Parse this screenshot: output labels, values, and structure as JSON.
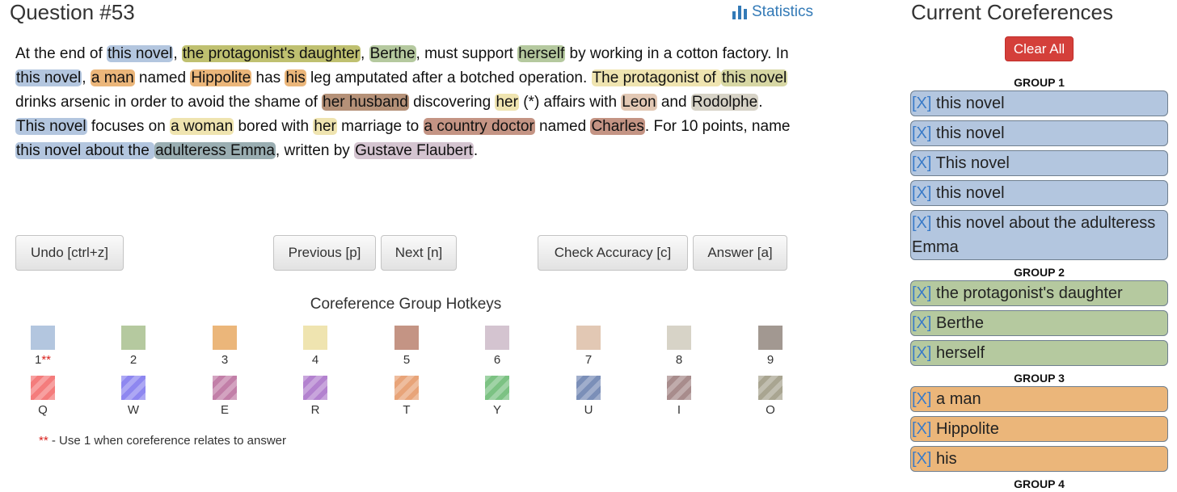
{
  "header": {
    "title": "Question #53",
    "stats_label": "Statistics"
  },
  "question": {
    "segments": [
      {
        "t": "At the end of "
      },
      {
        "t": "this novel",
        "g": "c1"
      },
      {
        "t": ", "
      },
      {
        "t": "the protagonist's daughter",
        "g": "c25"
      },
      {
        "t": ", "
      },
      {
        "t": "Berthe",
        "g": "c2"
      },
      {
        "t": ", must support "
      },
      {
        "t": "herself",
        "g": "c2"
      },
      {
        "t": " by working in a cotton factory. In "
      },
      {
        "t": "this novel",
        "g": "c1"
      },
      {
        "t": ", "
      },
      {
        "t": "a man",
        "g": "c3"
      },
      {
        "t": " named "
      },
      {
        "t": "Hippolite",
        "g": "c3"
      },
      {
        "t": " has "
      },
      {
        "t": "his",
        "g": "c3"
      },
      {
        "t": " leg amputated after a botched operation. "
      },
      {
        "t": "The protagonist of ",
        "g": "c4"
      },
      {
        "t": "this novel",
        "g": "c4g"
      },
      {
        "t": " drinks arsenic in order to avoid the shame of "
      },
      {
        "t": "her husband",
        "g": "c45"
      },
      {
        "t": " discovering "
      },
      {
        "t": "her",
        "g": "c4"
      },
      {
        "t": " (*) affairs with "
      },
      {
        "t": "Leon",
        "g": "c7"
      },
      {
        "t": " and "
      },
      {
        "t": "Rodolphe",
        "g": "c8"
      },
      {
        "t": ". "
      },
      {
        "t": "This novel",
        "g": "c1"
      },
      {
        "t": " focuses on "
      },
      {
        "t": "a woman",
        "g": "c4"
      },
      {
        "t": " bored with "
      },
      {
        "t": "her",
        "g": "c4"
      },
      {
        "t": " marriage to "
      },
      {
        "t": "a country doctor",
        "g": "c5"
      },
      {
        "t": " named "
      },
      {
        "t": "Charles",
        "g": "c5"
      },
      {
        "t": ". For 10 points, name "
      },
      {
        "t": "this novel about the ",
        "g": "c1"
      },
      {
        "t": "adulteress Emma",
        "g": "c1g"
      },
      {
        "t": ", written by "
      },
      {
        "t": "Gustave Flaubert",
        "g": "c6"
      },
      {
        "t": "."
      }
    ]
  },
  "buttons": {
    "undo": "Undo [ctrl+z]",
    "previous": "Previous [p]",
    "next": "Next [n]",
    "check": "Check Accuracy [c]",
    "answer": "Answer [a]"
  },
  "hotkeys": {
    "title": "Coreference Group Hotkeys",
    "row1": [
      {
        "key": "1",
        "color": "#b3c6df",
        "mark": "**"
      },
      {
        "key": "2",
        "color": "#b5c99f"
      },
      {
        "key": "3",
        "color": "#ebb67a"
      },
      {
        "key": "4",
        "color": "#efe4b0"
      },
      {
        "key": "5",
        "color": "#c49484"
      },
      {
        "key": "6",
        "color": "#d4c4d0"
      },
      {
        "key": "7",
        "color": "#e2c8b4"
      },
      {
        "key": "8",
        "color": "#d7d3c7"
      },
      {
        "key": "9",
        "color": "#a29891"
      }
    ],
    "row2": [
      {
        "key": "Q",
        "color": "#f47c7c"
      },
      {
        "key": "W",
        "color": "#8e87f0"
      },
      {
        "key": "E",
        "color": "#c27fa8"
      },
      {
        "key": "R",
        "color": "#b382cf"
      },
      {
        "key": "T",
        "color": "#e8a479"
      },
      {
        "key": "Y",
        "color": "#7cc283"
      },
      {
        "key": "U",
        "color": "#7b8fb8"
      },
      {
        "key": "I",
        "color": "#a88c8c"
      },
      {
        "key": "O",
        "color": "#a9a591"
      }
    ],
    "note_mark": "**",
    "note_text": " - Use 1 when coreference relates to answer"
  },
  "panel": {
    "title": "Current Coreferences",
    "clear_label": "Clear All",
    "remove_label": "[X]",
    "groups": [
      {
        "label": "GROUP 1",
        "color": "#b3c6df",
        "items": [
          "this novel",
          "this novel",
          "This novel",
          "this novel",
          "this novel about the adulteress Emma"
        ]
      },
      {
        "label": "GROUP 2",
        "color": "#b5c99f",
        "items": [
          "the protagonist's daughter",
          "Berthe",
          "herself"
        ]
      },
      {
        "label": "GROUP 3",
        "color": "#ebb67a",
        "items": [
          "a man",
          "Hippolite",
          "his"
        ]
      },
      {
        "label": "GROUP 4",
        "color": "#efe4b0",
        "items": []
      }
    ]
  }
}
